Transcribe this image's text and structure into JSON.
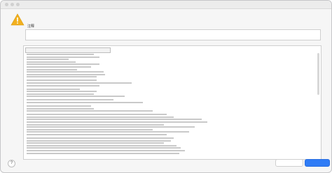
{
  "window": {
    "title": "",
    "heading": "",
    "subtext": "",
    "comments_label": "注释",
    "details_label": "",
    "report_tab_label": "",
    "hide_details_label": "",
    "secondary_button_label": "",
    "primary_button_label": ""
  },
  "colors": {
    "accent": "#2f7cf6",
    "warning": "#f2b01e"
  },
  "report_lines": [
    [
      96
    ],
    [
      104
    ],
    [
      60
    ],
    [
      70
    ],
    [
      104
    ],
    [
      92
    ],
    [
      72
    ],
    [
      110
    ],
    [
      112
    ],
    [
      100
    ],
    [
      100
    ],
    [
      150
    ],
    [
      104
    ],
    [
      76
    ],
    [
      100
    ],
    [
      96
    ],
    [
      140
    ],
    [
      124
    ],
    [
      166
    ],
    [
      92
    ],
    [
      96
    ],
    [
      180
    ],
    [
      200
    ],
    [
      210
    ],
    [
      250
    ],
    [
      258
    ],
    [
      196
    ],
    [
      240
    ],
    [
      180
    ],
    [
      232
    ],
    [
      200
    ],
    [
      210
    ],
    [
      206
    ],
    [
      196
    ],
    [
      214
    ],
    [
      220
    ],
    [
      226
    ],
    [
      218
    ]
  ]
}
